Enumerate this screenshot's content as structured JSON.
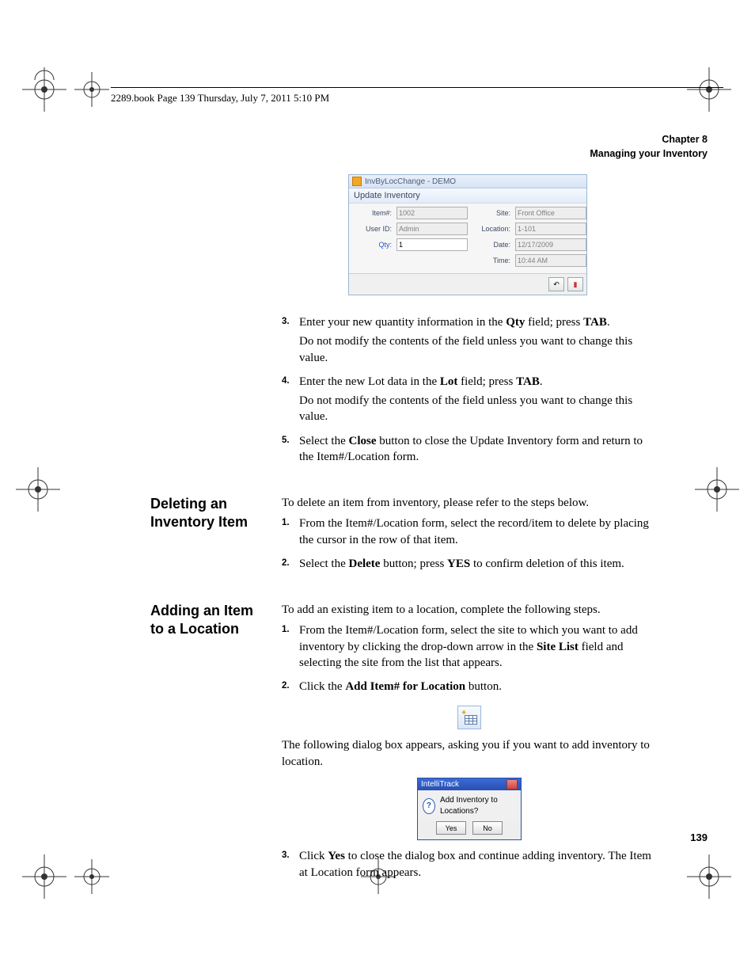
{
  "running_header": "2289.book  Page 139  Thursday, July 7, 2011  5:10 PM",
  "chapter": {
    "line1": "Chapter 8",
    "line2": "Managing your Inventory"
  },
  "page_number": "139",
  "win1": {
    "title": "InvByLocChange - DEMO",
    "subtitle": "Update Inventory",
    "labels": {
      "item": "Item#:",
      "user": "User ID:",
      "qty": "Qty:",
      "site": "Site:",
      "location": "Location:",
      "date": "Date:",
      "time": "Time:"
    },
    "values": {
      "item": "1002",
      "user": "Admin",
      "qty": "1",
      "site": "Front Office",
      "location": "1-101",
      "date": "12/17/2009",
      "time": "10:44 AM"
    }
  },
  "section_continuation": {
    "step3": {
      "a": "Enter your new quantity information in the ",
      "b": "Qty",
      "c": " field; press ",
      "d": "TAB",
      "e": ".",
      "sub": "Do not modify the contents of the field unless you want to change this value."
    },
    "step4": {
      "a": "Enter the new Lot data in the ",
      "b": "Lot",
      "c": " field; press ",
      "d": "TAB",
      "e": ".",
      "sub": "Do not modify the contents of the field unless you want to change this value."
    },
    "step5": {
      "a": "Select the ",
      "b": "Close",
      "c": " button to close the Update Inventory form and return to the Item#/Location form."
    }
  },
  "section_delete": {
    "heading": "Deleting an Inventory Item",
    "intro": "To delete an item from inventory, please refer to the steps below.",
    "step1": "From the Item#/Location form, select the record/item to delete by placing the cursor in the row of that item.",
    "step2": {
      "a": "Select the ",
      "b": "Delete",
      "c": " button; press ",
      "d": "YES",
      "e": " to confirm deletion of this item."
    }
  },
  "section_add": {
    "heading": "Adding an Item to a Location",
    "intro": "To add an existing item to a location, complete the following steps.",
    "step1": {
      "a": "From the Item#/Location form, select the site to which you want to add inventory by clicking the drop-down arrow in the ",
      "b": "Site List",
      "c": " field and selecting the site from the list that appears."
    },
    "step2": {
      "a": "Click the ",
      "b": "Add Item# for Location",
      "c": " button."
    },
    "after_btn": "The following dialog box appears, asking you if you want to add inventory to location.",
    "dlg": {
      "title": "IntelliTrack",
      "msg": "Add Inventory to Locations?",
      "yes": "Yes",
      "no": "No"
    },
    "step3": {
      "a": "Click ",
      "b": "Yes",
      "c": " to close the dialog box and continue adding inventory. The Item at Location form appears."
    }
  }
}
